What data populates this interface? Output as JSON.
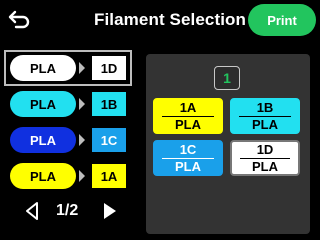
{
  "header": {
    "back_icon": "back-arrow-icon",
    "title": "Filament Selection",
    "print_label": "Print"
  },
  "colors": {
    "accent_green": "#22c55e",
    "white": "#ffffff",
    "cyan": "#22e0f0",
    "blue": "#1030e0",
    "yellow": "#ffff00",
    "sky": "#1aa0ea",
    "panel": "#333333"
  },
  "filaments": [
    {
      "material": "PLA",
      "slot": "1D",
      "pill_color": "#ffffff",
      "slot_color": "#ffffff",
      "pill_text": "#000000",
      "selected": true
    },
    {
      "material": "PLA",
      "slot": "1B",
      "pill_color": "#22e0f0",
      "slot_color": "#22e0f0",
      "pill_text": "#000000",
      "selected": false
    },
    {
      "material": "PLA",
      "slot": "1C",
      "pill_color": "#1030e0",
      "slot_color": "#1aa0ea",
      "pill_text": "#ffffff",
      "selected": false
    },
    {
      "material": "PLA",
      "slot": "1A",
      "pill_color": "#ffff00",
      "slot_color": "#ffff00",
      "pill_text": "#000000",
      "selected": false
    }
  ],
  "pager": {
    "text": "1/2",
    "prev_icon": "chevron-left-icon",
    "next_icon": "play-right-icon"
  },
  "unit": {
    "number": "1",
    "slots": [
      {
        "id": "1A",
        "material": "PLA",
        "bg": "#ffff00",
        "text": "#000000"
      },
      {
        "id": "1B",
        "material": "PLA",
        "bg": "#22e0f0",
        "text": "#000000"
      },
      {
        "id": "1C",
        "material": "PLA",
        "bg": "#1aa0ea",
        "text": "#ffffff"
      },
      {
        "id": "1D",
        "material": "PLA",
        "bg": "#ffffff",
        "text": "#000000"
      }
    ]
  }
}
